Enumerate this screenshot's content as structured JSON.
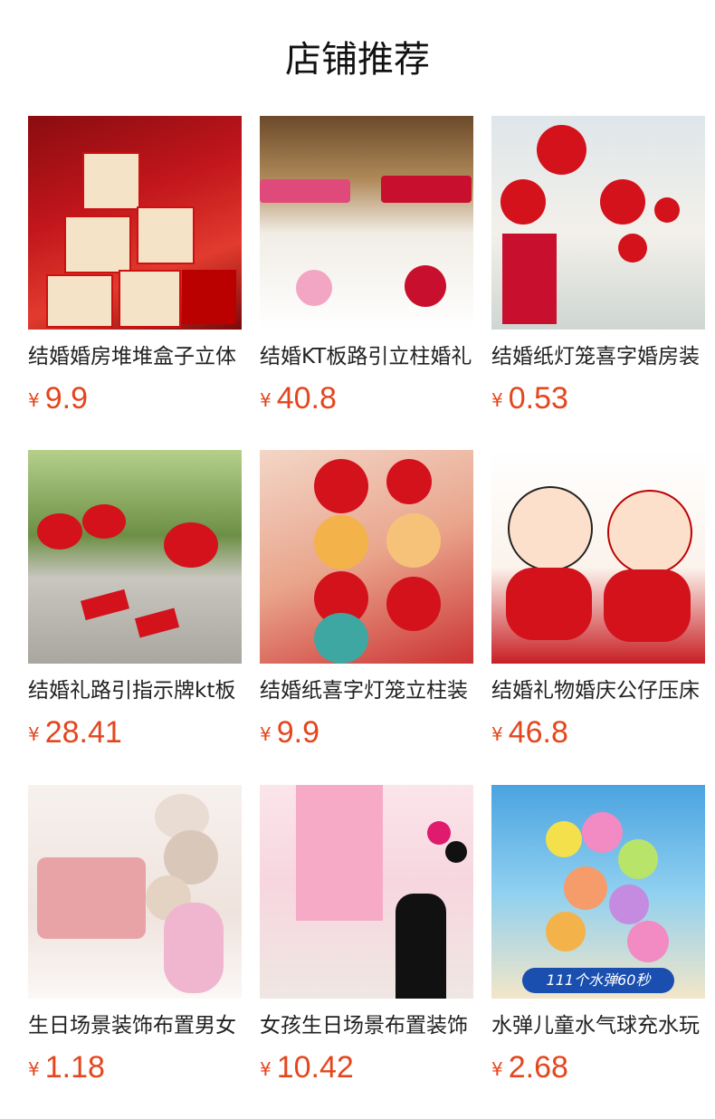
{
  "page": {
    "title": "店铺推荐"
  },
  "currency": "¥",
  "products": [
    {
      "name": "结婚婚房堆堆盒子立体",
      "price": "9.9",
      "image": "wedding-gift-boxes"
    },
    {
      "name": "结婚KT板路引立柱婚礼",
      "price": "40.8",
      "image": "wedding-signpost-boards"
    },
    {
      "name": "结婚纸灯笼喜字婚房装",
      "price": "0.53",
      "image": "red-paper-lanterns"
    },
    {
      "name": "结婚礼路引指示牌kt板",
      "price": "28.41",
      "image": "wedding-direction-signs"
    },
    {
      "name": "结婚纸喜字灯笼立柱装",
      "price": "9.9",
      "image": "lantern-pillars"
    },
    {
      "name": "结婚礼物婚庆公仔压床",
      "price": "46.8",
      "image": "wedding-plush-dolls"
    },
    {
      "name": "生日场景装饰布置男女",
      "price": "1.18",
      "image": "birthday-cake-balloons"
    },
    {
      "name": "女孩生日场景布置装饰",
      "price": "10.42",
      "image": "princess-birthday-decor"
    },
    {
      "name": "水弹儿童水气球充水玩",
      "price": "2.68",
      "image": "water-balloons"
    }
  ],
  "image_texts": {
    "water_balloons_banner": "111个水弹60秒"
  },
  "colors": {
    "price": "#e4461e",
    "title": "#111111"
  }
}
